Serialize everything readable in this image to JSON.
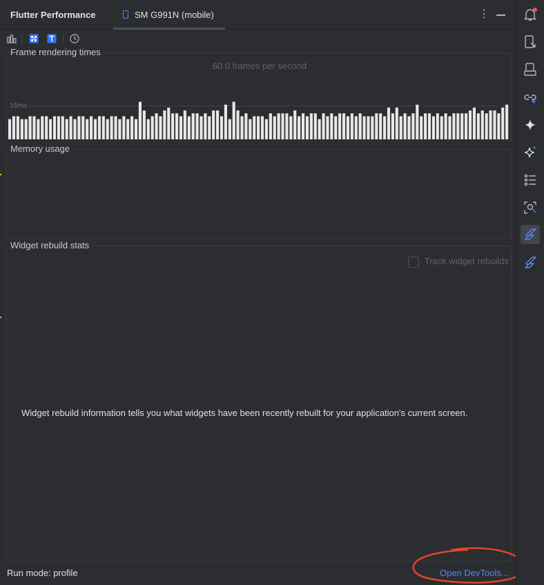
{
  "header": {
    "title": "Flutter Performance",
    "device_tab": "SM G991N (mobile)"
  },
  "toolbar": {
    "icons": [
      "bar-chart-icon",
      "repaint-rainbow-icon",
      "text-baseline-icon",
      "clock-icon"
    ]
  },
  "frame_rendering": {
    "title": "Frame rendering times",
    "fps_label": "60.0 frames per second",
    "threshold_label": "16ms",
    "frame_times_ms": [
      7,
      8,
      8,
      7,
      7,
      8,
      8,
      7,
      8,
      8,
      7,
      8,
      8,
      8,
      7,
      8,
      7,
      8,
      8,
      7,
      8,
      7,
      8,
      8,
      7,
      8,
      8,
      7,
      8,
      7,
      8,
      7,
      13,
      10,
      7,
      8,
      9,
      8,
      10,
      11,
      9,
      9,
      8,
      10,
      8,
      9,
      9,
      8,
      9,
      8,
      10,
      10,
      8,
      12,
      7,
      13,
      10,
      8,
      9,
      7,
      8,
      8,
      8,
      7,
      9,
      8,
      9,
      9,
      9,
      8,
      10,
      8,
      9,
      8,
      9,
      9,
      7,
      9,
      8,
      9,
      8,
      9,
      9,
      8,
      9,
      8,
      9,
      8,
      8,
      8,
      9,
      9,
      8,
      11,
      9,
      11,
      8,
      9,
      8,
      9,
      12,
      8,
      9,
      9,
      8,
      9,
      8,
      9,
      8,
      9,
      9,
      9,
      9,
      10,
      11,
      9,
      10,
      9,
      10,
      10,
      9,
      11,
      12
    ]
  },
  "memory": {
    "title": "Memory usage"
  },
  "widget_rebuild": {
    "title": "Widget rebuild stats",
    "track_label": "Track widget rebuilds",
    "track_checked": false,
    "info_text": "Widget rebuild information tells you what widgets have been recently rebuilt for your application's current screen."
  },
  "footer": {
    "run_mode": "Run mode: profile",
    "devtools_link": "Open DevTools..."
  },
  "sidebar": {
    "icons": [
      "notifications-icon",
      "device-manager-icon",
      "running-devices-icon",
      "app-links-icon",
      "gemini-icon",
      "ai-assistant-icon",
      "structure-icon",
      "inspector-icon",
      "flutter-performance-icon",
      "flutter-inspector-icon"
    ],
    "selected": "flutter-performance-icon"
  },
  "colors": {
    "accent": "#548af7",
    "annotation": "#e0472b",
    "notification_dot": "#e55765",
    "bar": "#e8e8e8"
  }
}
